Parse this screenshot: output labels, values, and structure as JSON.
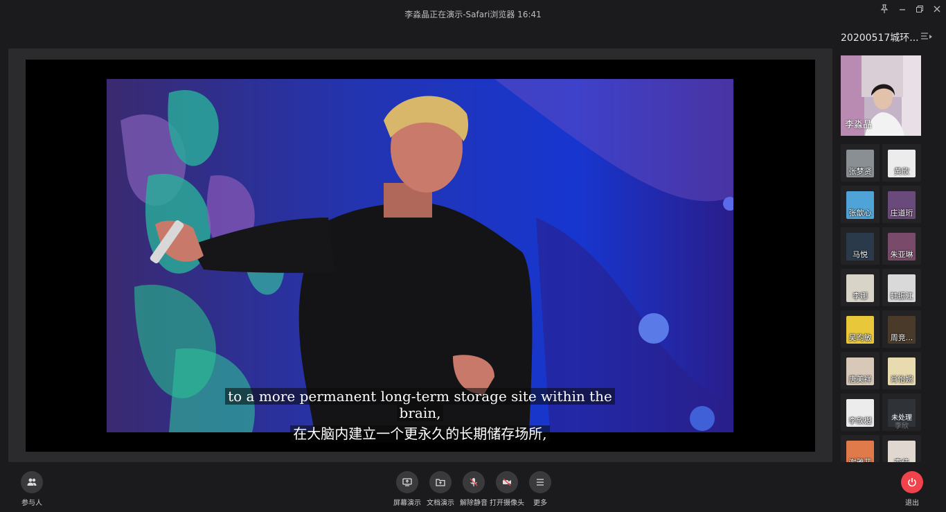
{
  "window": {
    "title": "李淼晶正在演示-Safari浏览器 16:41"
  },
  "sidebar": {
    "meeting_name": "20200517城环...",
    "main_participant": "李淼晶",
    "participants": [
      {
        "name": "张梦贤",
        "color": "#8a8f93"
      },
      {
        "name": "黄欣",
        "color": "#ececec"
      },
      {
        "name": "张歆心",
        "color": "#4fa3d6"
      },
      {
        "name": "庄道珩",
        "color": "#6a4a7a"
      },
      {
        "name": "马悦",
        "color": "#2a3a4a"
      },
      {
        "name": "朱亚琳",
        "color": "#7a4a6a"
      },
      {
        "name": "李娜",
        "color": "#d8d4c8"
      },
      {
        "name": "韩振江",
        "color": "#d9d9d9"
      },
      {
        "name": "吴昀敏",
        "color": "#e8c83a"
      },
      {
        "name": "周竞...",
        "color": "#4a3a2a"
      },
      {
        "name": "唐美祥",
        "color": "#d8c8b8"
      },
      {
        "name": "肖怡婉",
        "color": "#e9dbb0"
      },
      {
        "name": "李欣樾",
        "color": "#ececec"
      },
      {
        "name": "未处理",
        "sub": "李欣",
        "color": "#2f3338"
      },
      {
        "name": "谢雅菲",
        "color": "#e07a4a"
      },
      {
        "name": "李佳",
        "color": "#e0d8d0"
      }
    ]
  },
  "video": {
    "subtitle_en_line1": "to a more permanent long-term storage site within the",
    "subtitle_en_line2": "brain,",
    "subtitle_zh": "在大脑内建立一个更永久的长期储存场所,"
  },
  "toolbar": {
    "participants": "参与人",
    "screen_share": "屏幕演示",
    "doc_share": "文档演示",
    "unmute": "解除静音",
    "camera": "打开摄像头",
    "more": "更多",
    "exit": "退出"
  },
  "colors": {
    "exit": "#f0434b",
    "background": "#1b1b1d"
  }
}
